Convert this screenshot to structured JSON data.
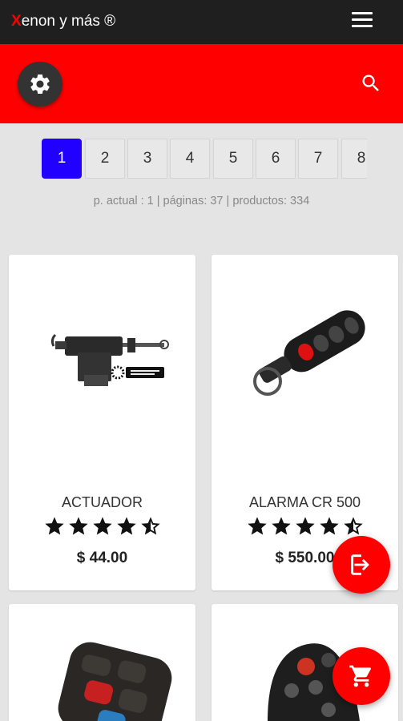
{
  "header": {
    "brand_first_letter": "X",
    "brand_rest": "enon y más ®",
    "menu_icon": "hamburger-menu-icon"
  },
  "toolbar": {
    "settings_icon": "gear-icon",
    "search_icon": "search-icon"
  },
  "pagination": {
    "pages": [
      "1",
      "2",
      "3",
      "4",
      "5",
      "6",
      "7",
      "8"
    ],
    "active": "1",
    "info": "p. actual : 1 | páginas: 37 | productos: 334"
  },
  "products": [
    {
      "name": "ACTUADOR",
      "price": "$ 44.00",
      "rating": 4.5
    },
    {
      "name": "ALARMA CR 500",
      "price": "$ 550.00",
      "rating": 4.5
    },
    {
      "name": "",
      "price": "",
      "rating": null
    },
    {
      "name": "",
      "price": "",
      "rating": null
    }
  ],
  "fabs": {
    "login_icon": "login-icon",
    "cart_icon": "cart-icon"
  },
  "colors": {
    "brand_red": "#ff0000",
    "header_dark": "#1f1f1f",
    "active_page": "#2200ff"
  }
}
